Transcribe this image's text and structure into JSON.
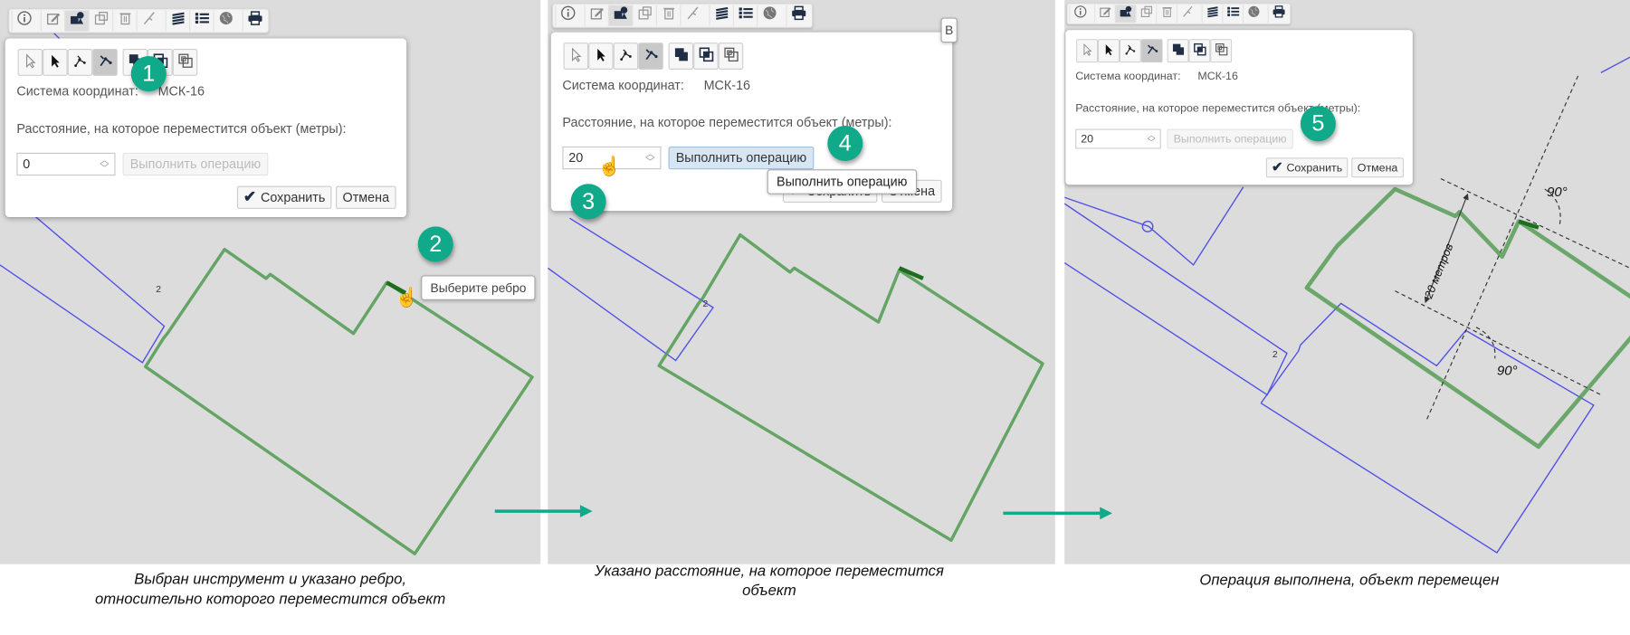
{
  "toolbar_icons": [
    "info-icon",
    "edit-icon",
    "shapes-icon",
    "export-icon",
    "trash-icon",
    "measure-icon",
    "layers-icon",
    "list-icon",
    "globe-icon",
    "print-icon"
  ],
  "dialog_tool_icons": [
    "select-arrow-outline-icon",
    "select-arrow-icon",
    "edit-vertices-icon",
    "move-edge-icon",
    "union-icon",
    "intersect-icon",
    "difference-icon"
  ],
  "colors": {
    "map_bg": "#dcdcdc",
    "object_green": "#4f9a4f",
    "selected_edge": "#1e6e1e",
    "parcel_blue": "#5050e6",
    "badge": "#10a98a",
    "exec_active_bg": "#d6e6f4"
  },
  "panels": [
    {
      "coord_label": "Система координат:",
      "coord_value": "МСК-16",
      "distance_label": "Расстояние, на которое переместится объект (метры):",
      "distance_value": "0",
      "exec_label": "Выполнить операцию",
      "save_label": "Сохранить",
      "cancel_label": "Отмена",
      "tooltip": "Выберите ребро",
      "badges": [
        "1",
        "2"
      ],
      "caption": [
        "Выбран инструмент и указано ребро,",
        "относительно которого переместится объект"
      ],
      "parcel_label": "2"
    },
    {
      "coord_label": "Система координат:",
      "coord_value": "МСК-16",
      "distance_label": "Расстояние, на которое переместится объект (метры):",
      "distance_value": "20",
      "exec_label": "Выполнить операцию",
      "save_label": "Сохранить",
      "cancel_label": "Отмена",
      "tooltip": "Выполнить операцию",
      "partial_label": "В",
      "badges": [
        "3",
        "4"
      ],
      "caption": [
        "Указано расстояние, на которое переместится",
        "объект"
      ],
      "parcel_label": "2"
    },
    {
      "coord_label": "Система координат:",
      "coord_value": "МСК-16",
      "distance_label": "Расстояние, на которое переместится объект (метры):",
      "distance_value": "20",
      "exec_label": "Выполнить операцию",
      "save_label": "Сохранить",
      "cancel_label": "Отмена",
      "badges": [
        "5"
      ],
      "caption": [
        "Операция выполнена, объект перемещен"
      ],
      "angle_labels": [
        "90°",
        "90°"
      ],
      "distance_annotation": "20 метров",
      "parcel_label": "2"
    }
  ]
}
